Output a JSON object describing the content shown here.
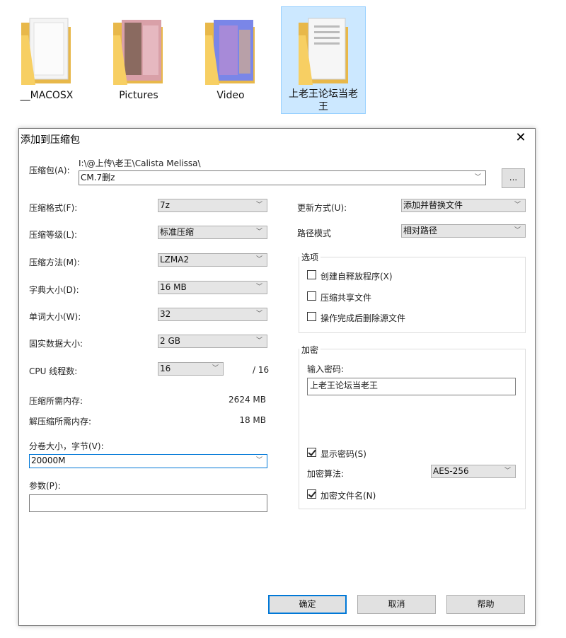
{
  "folders": [
    {
      "label": "__MACOSX",
      "selected": false
    },
    {
      "label": "Pictures",
      "selected": false
    },
    {
      "label": "Video",
      "selected": false
    },
    {
      "label": "上老王论坛当老王",
      "selected": true
    }
  ],
  "dialog": {
    "title": "添加到压缩包",
    "close_icon": "close-icon",
    "archive": {
      "label": "压缩包(A):",
      "path": "I:\\@上传\\老王\\Calista Melissa\\",
      "name": "CM.7删z",
      "browse_label": "..."
    },
    "left": {
      "format": {
        "label": "压缩格式(F):",
        "value": "7z"
      },
      "level": {
        "label": "压缩等级(L):",
        "value": "标准压缩"
      },
      "method": {
        "label": "压缩方法(M):",
        "value": "LZMA2"
      },
      "dict": {
        "label": "字典大小(D):",
        "value": "16 MB"
      },
      "word": {
        "label": "单词大小(W):",
        "value": "32"
      },
      "solid": {
        "label": "固实数据大小:",
        "value": "2 GB"
      },
      "threads": {
        "label": "CPU 线程数:",
        "value": "16",
        "total": "/ 16"
      },
      "mem_comp": {
        "label": "压缩所需内存:",
        "value": "2624 MB"
      },
      "mem_decomp": {
        "label": "解压缩所需内存:",
        "value": "18 MB"
      },
      "volume": {
        "label": "分卷大小，字节(V):",
        "value": "20000M"
      },
      "params": {
        "label": "参数(P):",
        "value": ""
      }
    },
    "right": {
      "update": {
        "label": "更新方式(U):",
        "value": "添加并替换文件"
      },
      "pathmode": {
        "label": "路径模式",
        "value": "相对路径"
      },
      "options": {
        "title": "选项",
        "sfx": "创建自释放程序(X)",
        "shared": "压缩共享文件",
        "delete": "操作完成后删除源文件"
      },
      "encryption": {
        "title": "加密",
        "pw_label": "输入密码:",
        "password": "上老王论坛当老王",
        "show_pw": "显示密码(S)",
        "method_label": "加密算法:",
        "method": "AES-256",
        "encrypt_names": "加密文件名(N)"
      }
    },
    "buttons": {
      "ok": "确定",
      "cancel": "取消",
      "help": "帮助"
    }
  }
}
